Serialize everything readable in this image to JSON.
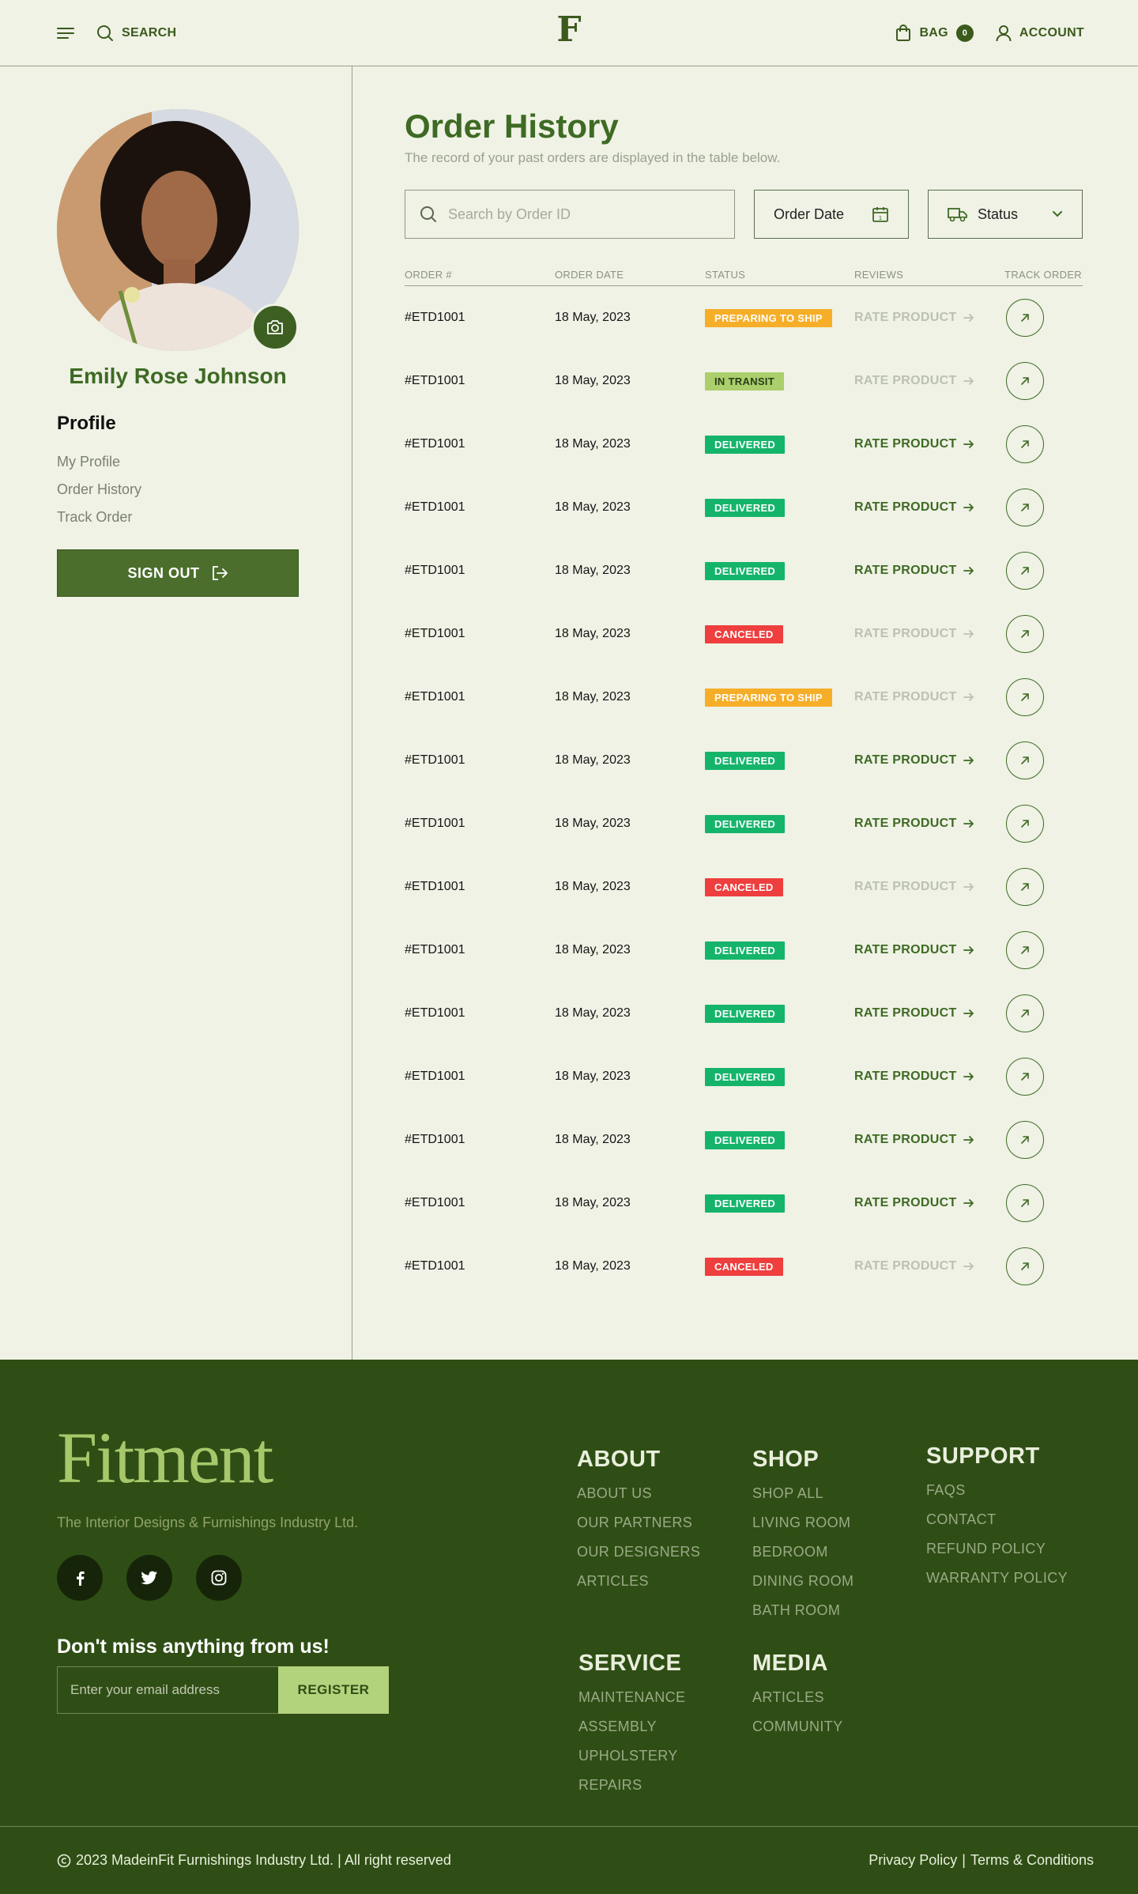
{
  "header": {
    "search_label": "SEARCH",
    "logo": "F",
    "bag_label": "BAG",
    "bag_count": "0",
    "account_label": "ACCOUNT"
  },
  "sidebar": {
    "user_name": "Emily Rose Johnson",
    "section_title": "Profile",
    "menu": [
      "My Profile",
      "Order History",
      "Track Order"
    ],
    "signout_label": "SIGN OUT"
  },
  "main": {
    "title": "Order History",
    "subtitle": "The record of your past orders are displayed in the table below.",
    "search_placeholder": "Search by Order ID",
    "date_filter_label": "Order Date",
    "status_filter_label": "Status",
    "columns": [
      "ORDER #",
      "ORDER DATE",
      "STATUS",
      "REVIEWS",
      "TRACK ORDER"
    ],
    "rate_label": "RATE PRODUCT",
    "orders": [
      {
        "id": "#ETD1001",
        "date": "18 May, 2023",
        "status": "PREPARING TO SHIP",
        "kind": "ship",
        "rate_enabled": false
      },
      {
        "id": "#ETD1001",
        "date": "18 May, 2023",
        "status": "IN TRANSIT",
        "kind": "transit",
        "rate_enabled": false
      },
      {
        "id": "#ETD1001",
        "date": "18 May, 2023",
        "status": "DELIVERED",
        "kind": "delivered",
        "rate_enabled": true
      },
      {
        "id": "#ETD1001",
        "date": "18 May, 2023",
        "status": "DELIVERED",
        "kind": "delivered",
        "rate_enabled": true
      },
      {
        "id": "#ETD1001",
        "date": "18 May, 2023",
        "status": "DELIVERED",
        "kind": "delivered",
        "rate_enabled": true
      },
      {
        "id": "#ETD1001",
        "date": "18 May, 2023",
        "status": "CANCELED",
        "kind": "canceled",
        "rate_enabled": false
      },
      {
        "id": "#ETD1001",
        "date": "18 May, 2023",
        "status": "PREPARING TO SHIP",
        "kind": "ship",
        "rate_enabled": false
      },
      {
        "id": "#ETD1001",
        "date": "18 May, 2023",
        "status": "DELIVERED",
        "kind": "delivered",
        "rate_enabled": true
      },
      {
        "id": "#ETD1001",
        "date": "18 May, 2023",
        "status": "DELIVERED",
        "kind": "delivered",
        "rate_enabled": true
      },
      {
        "id": "#ETD1001",
        "date": "18 May, 2023",
        "status": "CANCELED",
        "kind": "canceled",
        "rate_enabled": false
      },
      {
        "id": "#ETD1001",
        "date": "18 May, 2023",
        "status": "DELIVERED",
        "kind": "delivered",
        "rate_enabled": true
      },
      {
        "id": "#ETD1001",
        "date": "18 May, 2023",
        "status": "DELIVERED",
        "kind": "delivered",
        "rate_enabled": true
      },
      {
        "id": "#ETD1001",
        "date": "18 May, 2023",
        "status": "DELIVERED",
        "kind": "delivered",
        "rate_enabled": true
      },
      {
        "id": "#ETD1001",
        "date": "18 May, 2023",
        "status": "DELIVERED",
        "kind": "delivered",
        "rate_enabled": true
      },
      {
        "id": "#ETD1001",
        "date": "18 May, 2023",
        "status": "DELIVERED",
        "kind": "delivered",
        "rate_enabled": true
      },
      {
        "id": "#ETD1001",
        "date": "18 May, 2023",
        "status": "CANCELED",
        "kind": "canceled",
        "rate_enabled": false
      }
    ]
  },
  "footer": {
    "brand": "Fitment",
    "tagline": "The Interior Designs & Furnishings Industry Ltd.",
    "newsletter_title": "Don't miss anything from us!",
    "email_placeholder": "Enter your email address",
    "register_label": "REGISTER",
    "columns": {
      "about": {
        "title": "ABOUT",
        "links": [
          "ABOUT US",
          "OUR PARTNERS",
          "OUR DESIGNERS",
          "ARTICLES"
        ]
      },
      "shop": {
        "title": "SHOP",
        "links": [
          "SHOP ALL",
          "LIVING ROOM",
          "BEDROOM",
          "DINING ROOM",
          "BATH ROOM"
        ]
      },
      "support": {
        "title": "SUPPORT",
        "links": [
          "FAQS",
          "CONTACT",
          "REFUND POLICY",
          "WARRANTY POLICY"
        ]
      },
      "service": {
        "title": "SERVICE",
        "links": [
          "MAINTENANCE",
          "ASSEMBLY",
          "UPHOLSTERY",
          "REPAIRS"
        ]
      },
      "media": {
        "title": "MEDIA",
        "links": [
          "ARTICLES",
          "COMMUNITY"
        ]
      }
    },
    "copyright": "2023 MadeinFit Furnishings Industry Ltd.  | All right reserved",
    "privacy": "Privacy Policy",
    "separator": "|",
    "terms": "Terms & Conditions"
  },
  "colors": {
    "background": "#eff2e5",
    "brand_green": "#3e6a24",
    "footer_bg": "#2f4e15",
    "status_ship": "#f6ae29",
    "status_transit": "#aacf6c",
    "status_delivered": "#15b46b",
    "status_canceled": "#ee3e3e"
  }
}
